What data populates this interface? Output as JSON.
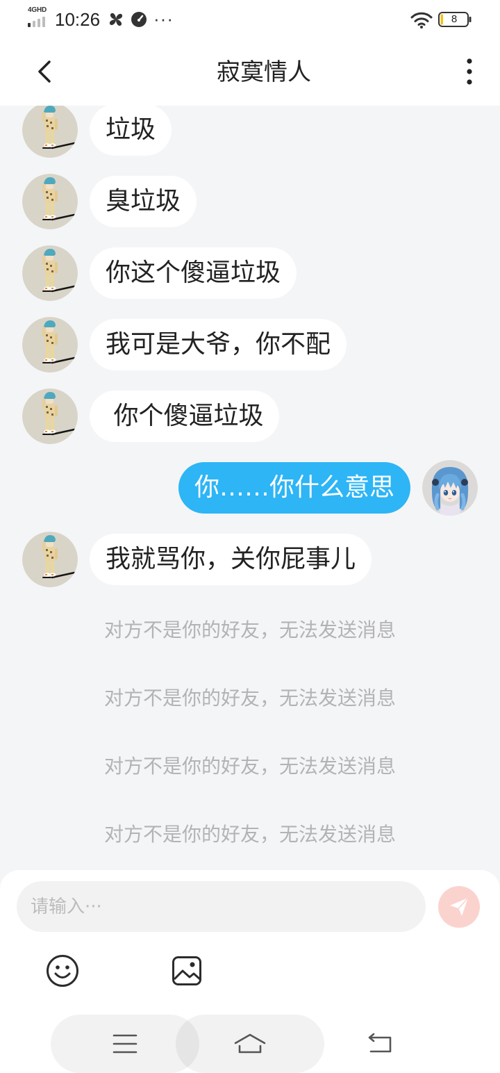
{
  "status_bar": {
    "network_label": "4GHD",
    "time": "10:26",
    "overflow": "···",
    "battery_level": "8",
    "icons": {
      "signal": "signal-icon",
      "app_a": "pinwheel-icon",
      "app_b": "speedometer-icon",
      "wifi": "wifi-icon",
      "battery": "battery-icon"
    }
  },
  "header": {
    "title": "寂寞情人",
    "icons": {
      "back": "chevron-left-icon",
      "more": "more-vertical-icon"
    }
  },
  "messages": [
    {
      "outgoing": false,
      "text": "垃圾"
    },
    {
      "outgoing": false,
      "text": "臭垃圾"
    },
    {
      "outgoing": false,
      "text": "你这个傻逼垃圾"
    },
    {
      "outgoing": false,
      "text": "我可是大爷，你不配"
    },
    {
      "outgoing": false,
      "text": " 你个傻逼垃圾"
    },
    {
      "outgoing": true,
      "text": "你……你什么意思"
    },
    {
      "outgoing": false,
      "text": "我就骂你，关你屁事儿"
    }
  ],
  "notices": [
    "对方不是你的好友，无法发送消息",
    "对方不是你的好友，无法发送消息",
    "对方不是你的好友，无法发送消息",
    "对方不是你的好友，无法发送消息"
  ],
  "composer": {
    "value": "",
    "placeholder": "请输入···",
    "icons": {
      "send": "paper-plane-icon",
      "emoji": "smiley-icon",
      "image": "image-icon"
    }
  },
  "nav_bar": {
    "icons": {
      "recents": "menu-icon",
      "home": "home-icon",
      "back": "back-arrow-icon"
    }
  },
  "colors": {
    "chat_background": "#f4f5f7",
    "incoming_bubble": "#ffffff",
    "outgoing_bubble": "#2db5f6",
    "notice_text": "#b3b3b3",
    "send_button": "#fbd3ce",
    "input_background": "#f2f2f2"
  }
}
